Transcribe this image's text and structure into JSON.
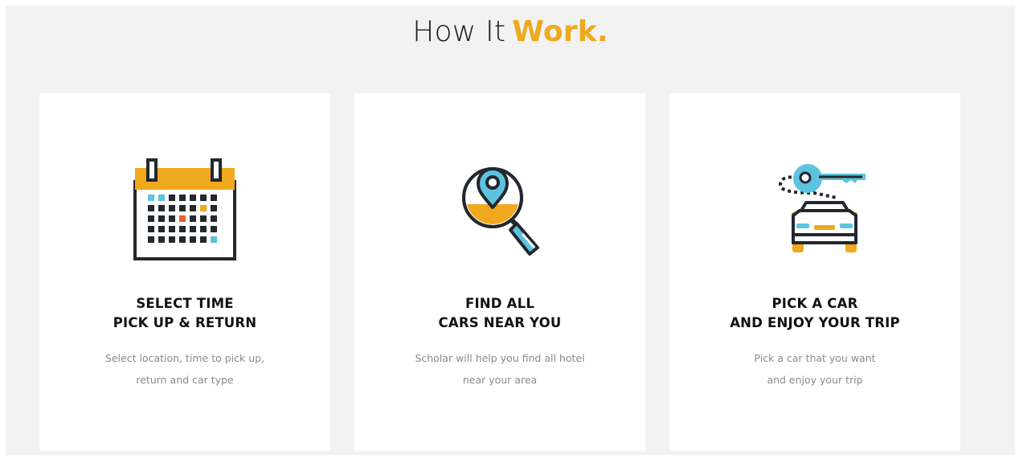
{
  "header": {
    "title_main": "How It",
    "title_accent": "Work."
  },
  "colors": {
    "accent": "#f0a81c",
    "blue": "#5cc3e0",
    "dark": "#23272e",
    "red": "#ef5b2d"
  },
  "steps": [
    {
      "icon": "calendar-icon",
      "heading_line1": "SELECT TIME",
      "heading_line2": "PICK UP & RETURN",
      "desc_line1": "Select location, time to pick up,",
      "desc_line2": "return and car type"
    },
    {
      "icon": "location-search-icon",
      "heading_line1": "FIND ALL",
      "heading_line2": "CARS NEAR YOU",
      "desc_line1": "Scholar will help you find all hotel",
      "desc_line2": "near your area"
    },
    {
      "icon": "car-key-icon",
      "heading_line1": "PICK A CAR",
      "heading_line2": "AND ENJOY YOUR TRIP",
      "desc_line1": "Pick a car that you want",
      "desc_line2": "and enjoy your trip"
    }
  ]
}
